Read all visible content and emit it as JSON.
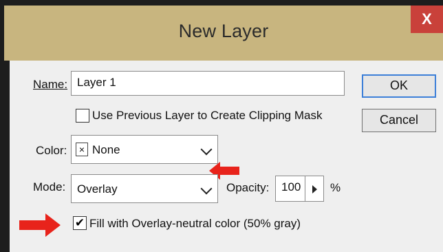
{
  "dialog": {
    "title": "New Layer",
    "close_label": "X"
  },
  "form": {
    "name_label": "Name:",
    "name_value": "Layer 1",
    "clipping_mask_label": "Use Previous Layer to Create Clipping Mask",
    "clipping_mask_checked": false,
    "color_label": "Color:",
    "color_value": "None",
    "color_swatch_glyph": "×",
    "mode_label": "Mode:",
    "mode_value": "Overlay",
    "opacity_label": "Opacity:",
    "opacity_value": "100",
    "opacity_unit": "%",
    "fill_label": "Fill with Overlay-neutral color (50% gray)",
    "fill_checked": true,
    "check_glyph": "✔"
  },
  "buttons": {
    "ok": "OK",
    "cancel": "Cancel"
  },
  "colors": {
    "titlebar": "#c8b57f",
    "close": "#c9413a",
    "annotation_arrow": "#e8231b",
    "ok_border": "#3c7fd8"
  }
}
